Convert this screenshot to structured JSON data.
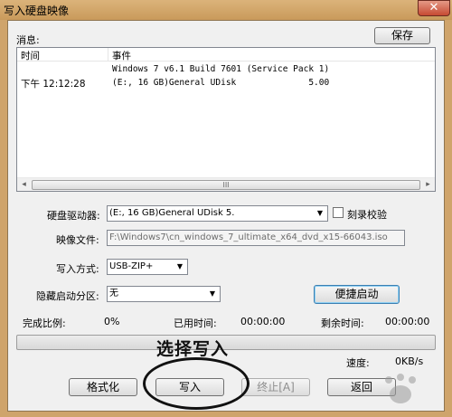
{
  "window": {
    "title": "写入硬盘映像",
    "close_glyph": "✕"
  },
  "log": {
    "label": "消息:",
    "save_button": "保存",
    "columns": [
      "时间",
      "事件"
    ],
    "rows": [
      {
        "time": "",
        "event": "Windows 7 v6.1 Build 7601 (Service Pack 1)"
      },
      {
        "time": "下午 12:12:28",
        "event": "(E:, 16 GB)General UDisk              5.00"
      }
    ],
    "scroll_thumb_glyph": "III",
    "scroll_left_glyph": "◂",
    "scroll_right_glyph": "▸"
  },
  "form": {
    "drive_label": "硬盘驱动器:",
    "drive_value": "(E:, 16 GB)General UDisk           5.",
    "verify_label": "刻录校验",
    "verify_checked": false,
    "image_label": "映像文件:",
    "image_value": "F:\\Windows7\\cn_windows_7_ultimate_x64_dvd_x15-66043.iso",
    "method_label": "写入方式:",
    "method_value": "USB-ZIP+",
    "hidden_partition_label": "隐藏启动分区:",
    "hidden_partition_value": "无",
    "quick_boot_button": "便捷启动",
    "dropdown_glyph": "▼"
  },
  "status": {
    "complete_label": "完成比例:",
    "complete_value": "0%",
    "elapsed_label": "已用时间:",
    "elapsed_value": "00:00:00",
    "remaining_label": "剩余时间:",
    "remaining_value": "00:00:00",
    "progress_fraction": 0,
    "speed_label": "速度:",
    "speed_value": "0KB/s"
  },
  "buttons": {
    "format": "格式化",
    "write": "写入",
    "abort": "终止[A]",
    "back": "返回"
  },
  "annotation": {
    "text": "选择写入"
  },
  "colors": {
    "window_frame": "#cfa46b",
    "client_bg": "#f0f0f0"
  }
}
